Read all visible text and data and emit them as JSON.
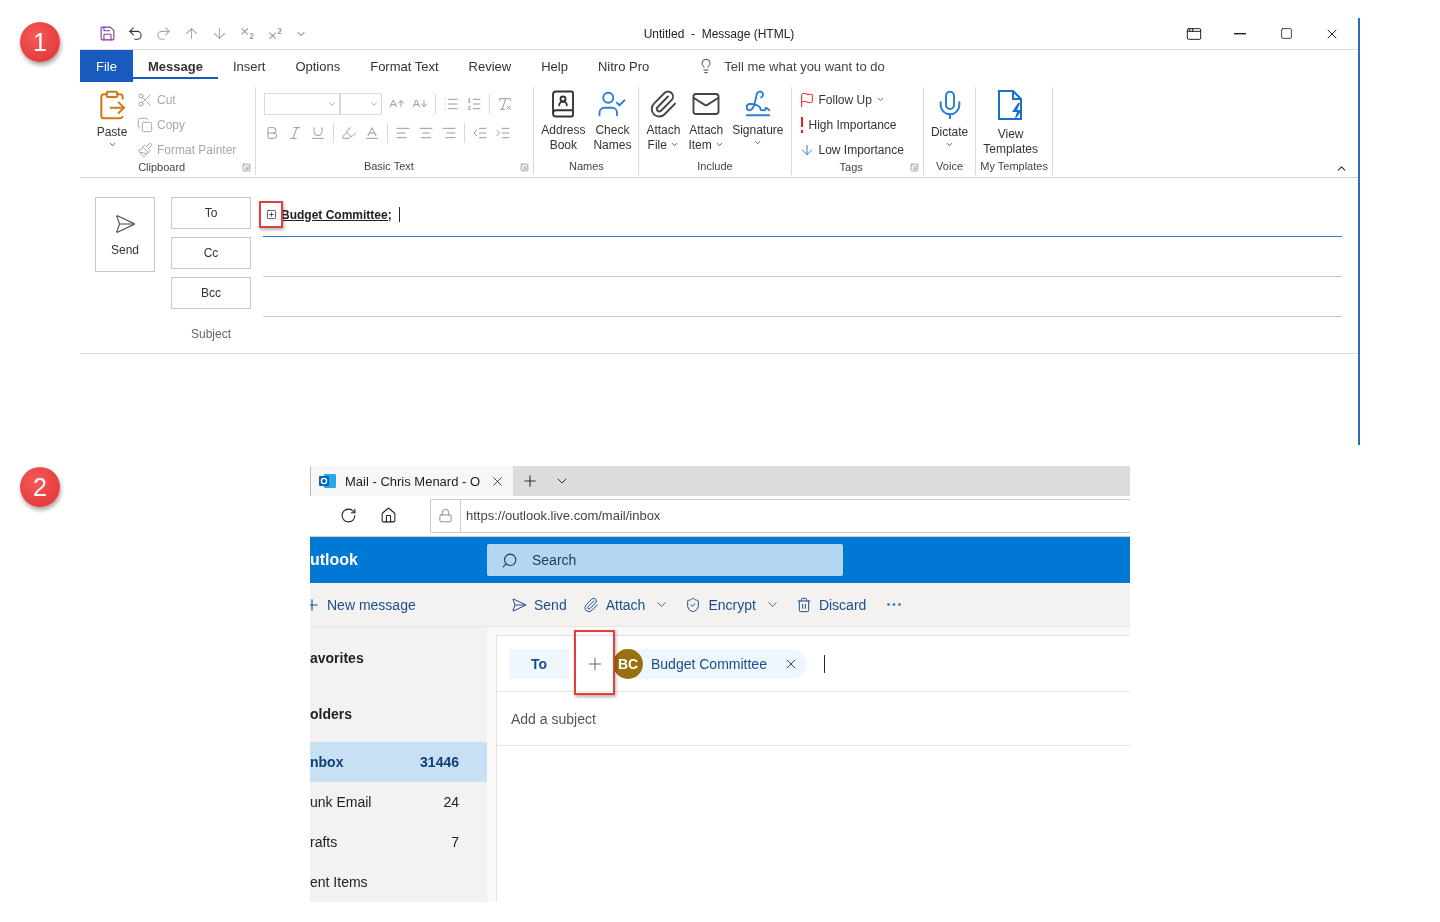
{
  "compose_window": {
    "callout": "1",
    "title": "Untitled  -  Message (HTML)",
    "tabs": [
      {
        "label": "File",
        "kind": "backstage",
        "selected": false
      },
      {
        "label": "Message",
        "kind": "tab",
        "selected": true
      },
      {
        "label": "Insert",
        "kind": "tab",
        "selected": false
      },
      {
        "label": "Options",
        "kind": "tab",
        "selected": false
      },
      {
        "label": "Format Text",
        "kind": "tab",
        "selected": false
      },
      {
        "label": "Review",
        "kind": "tab",
        "selected": false
      },
      {
        "label": "Help",
        "kind": "tab",
        "selected": false
      },
      {
        "label": "Nitro Pro",
        "kind": "tab",
        "selected": false
      }
    ],
    "tell_me": "Tell me what you want to do",
    "ribbon_groups": [
      {
        "kind": "clipboard",
        "label": "Clipboard",
        "launcher": true,
        "items": [
          {
            "kind": "large",
            "lines": [
              "Paste"
            ],
            "caret": true
          },
          {
            "kind": "small",
            "label": "Cut",
            "disabled": true,
            "caret": false
          },
          {
            "kind": "small",
            "label": "Copy",
            "disabled": true,
            "caret": false
          },
          {
            "kind": "small",
            "label": "Format Painter",
            "disabled": true,
            "caret": false
          }
        ]
      },
      {
        "kind": "basic_text",
        "label": "Basic Text",
        "launcher": true
      },
      {
        "kind": "names",
        "label": "Names",
        "launcher": false,
        "items": [
          {
            "kind": "large",
            "lines": [
              "Address",
              "Book"
            ],
            "caret": false
          },
          {
            "kind": "large",
            "lines": [
              "Check",
              "Names"
            ],
            "caret": false
          }
        ]
      },
      {
        "kind": "include",
        "label": "Include",
        "launcher": false,
        "items": [
          {
            "kind": "large",
            "lines": [
              "Attach",
              "File"
            ],
            "caret": true
          },
          {
            "kind": "large",
            "lines": [
              "Attach",
              "Item"
            ],
            "caret": true
          },
          {
            "kind": "large",
            "lines": [
              "Signature"
            ],
            "caret": true
          }
        ]
      },
      {
        "kind": "tags",
        "label": "Tags",
        "launcher": true,
        "items": [
          {
            "kind": "small",
            "label": "Follow Up",
            "disabled": false,
            "caret": true
          },
          {
            "kind": "small",
            "label": "High Importance",
            "disabled": false,
            "caret": false
          },
          {
            "kind": "small",
            "label": "Low Importance",
            "disabled": false,
            "caret": false
          }
        ]
      },
      {
        "kind": "voice",
        "label": "Voice",
        "launcher": false,
        "items": [
          {
            "kind": "large",
            "lines": [
              "Dictate"
            ],
            "caret": true
          }
        ]
      },
      {
        "kind": "templates",
        "label": "My Templates",
        "launcher": false,
        "items": [
          {
            "kind": "large",
            "lines": [
              "View",
              "Templates"
            ],
            "caret": false
          }
        ]
      }
    ],
    "send_button": "Send",
    "address_buttons": [
      "To",
      "Cc",
      "Bcc"
    ],
    "subject_label": "Subject",
    "recipient": "Budget Committee;"
  },
  "browser_window": {
    "callout": "2",
    "tab_title": "Mail - Chris Menard - O",
    "url": "https://outlook.live.com/mail/inbox",
    "app_name": "utlook",
    "search_placeholder": "Search",
    "new_message": "New message",
    "actions": [
      {
        "label": "Send",
        "caret": false
      },
      {
        "label": "Attach",
        "caret": true
      },
      {
        "label": "Encrypt",
        "caret": true
      },
      {
        "label": "Discard",
        "caret": false
      }
    ],
    "folders": [
      {
        "kind": "heading",
        "label": "avorites"
      },
      {
        "kind": "heading",
        "label": "olders"
      },
      {
        "kind": "folder",
        "label": "nbox",
        "count": "31446",
        "selected": true
      },
      {
        "kind": "folder",
        "label": "unk Email",
        "count": "24",
        "selected": false
      },
      {
        "kind": "folder",
        "label": "rafts",
        "count": "7",
        "selected": false
      },
      {
        "kind": "folder",
        "label": "ent Items",
        "selected": false
      }
    ],
    "compose": {
      "to_button": "To",
      "recipient": {
        "initials": "BC",
        "name": "Budget Committee"
      },
      "subject_placeholder": "Add a subject"
    }
  }
}
